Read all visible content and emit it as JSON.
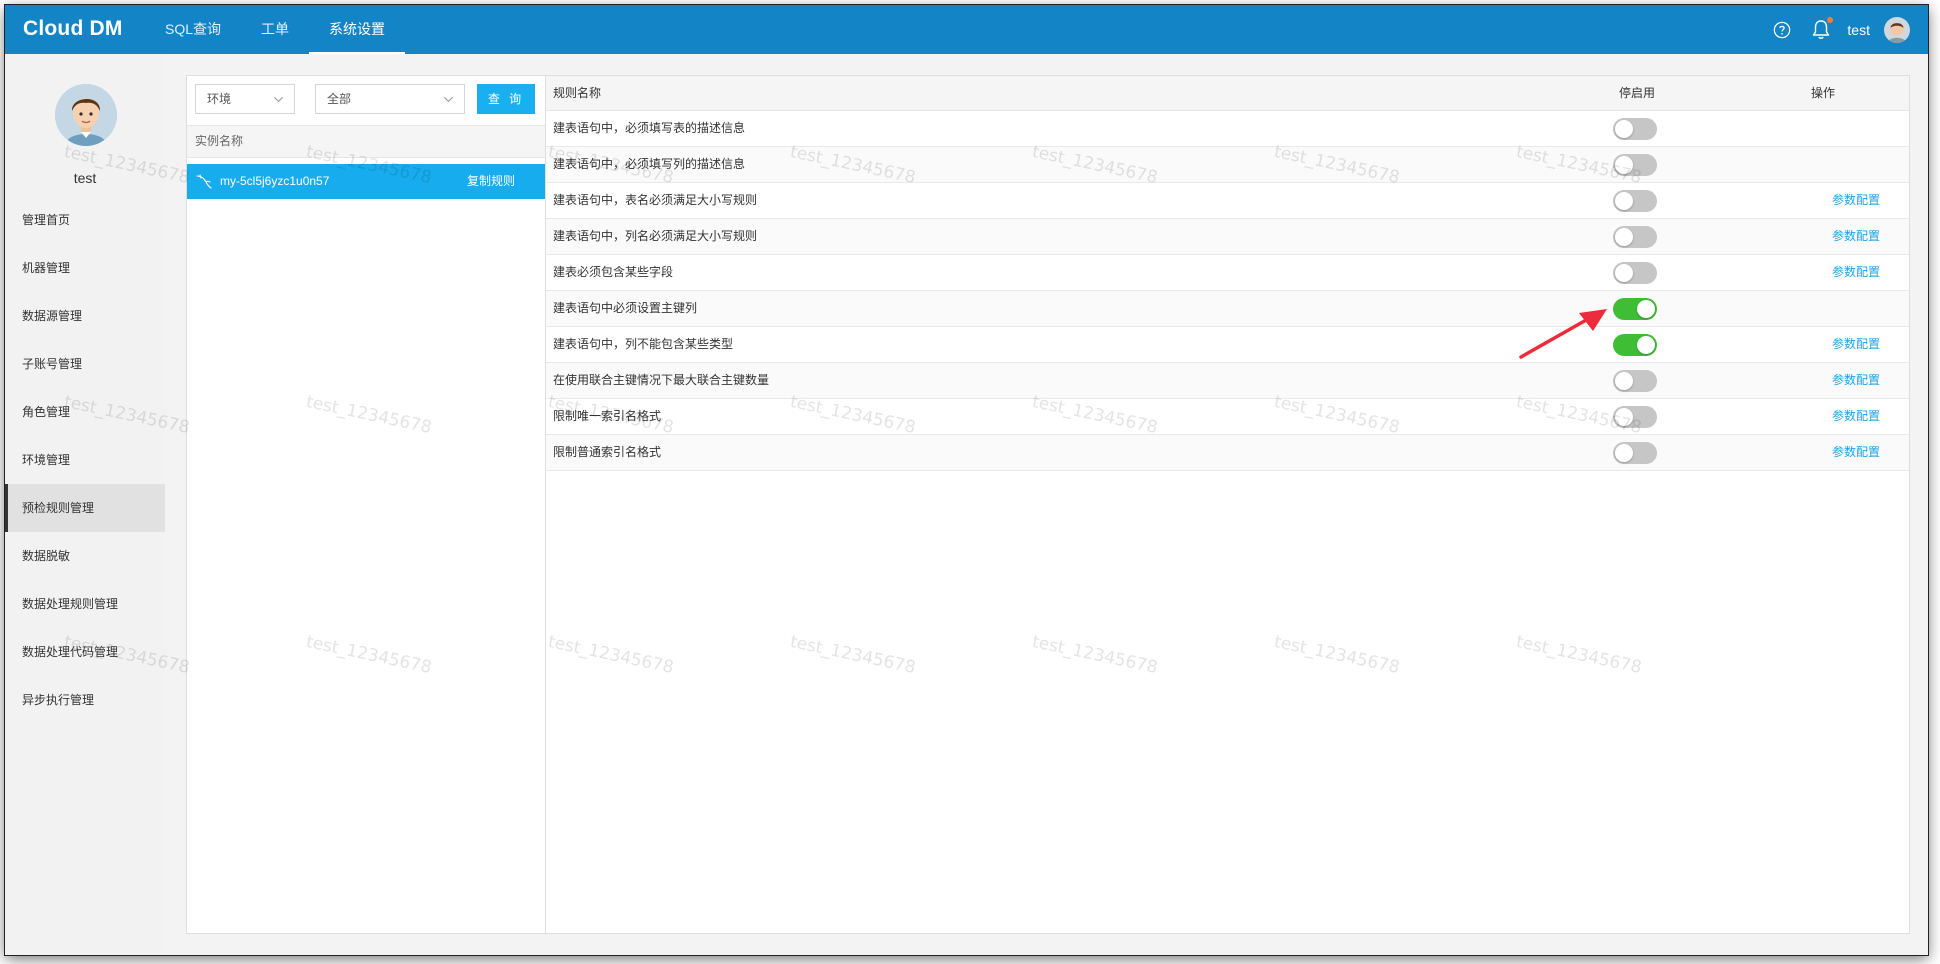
{
  "app": {
    "logo": "Cloud DM"
  },
  "topnav": [
    {
      "label": "SQL查询"
    },
    {
      "label": "工单"
    },
    {
      "label": "系统设置"
    }
  ],
  "top_right": {
    "username": "test",
    "help_icon": "question-circle-icon",
    "bell_icon": "bell-icon"
  },
  "sidebar": {
    "username": "test",
    "items": [
      {
        "label": "管理首页"
      },
      {
        "label": "机器管理"
      },
      {
        "label": "数据源管理"
      },
      {
        "label": "子账号管理"
      },
      {
        "label": "角色管理"
      },
      {
        "label": "环境管理"
      },
      {
        "label": "预检规则管理"
      },
      {
        "label": "数据脱敏"
      },
      {
        "label": "数据处理规则管理"
      },
      {
        "label": "数据处理代码管理"
      },
      {
        "label": "异步执行管理"
      }
    ],
    "active_index": 6
  },
  "left_panel": {
    "filter_env": "环境",
    "filter_all": "全部",
    "query_button": "查 询",
    "header": "实例名称",
    "instance": {
      "name": "my-5cl5j6yzc1u0n57",
      "copy_label": "复制规则"
    }
  },
  "rules_table": {
    "headers": {
      "name": "规则名称",
      "toggle": "停启用",
      "action": "操作"
    },
    "rows": [
      {
        "name": "建表语句中，必须填写表的描述信息",
        "enabled": false,
        "action": ""
      },
      {
        "name": "建表语句中，必须填写列的描述信息",
        "enabled": false,
        "action": ""
      },
      {
        "name": "建表语句中，表名必须满足大小写规则",
        "enabled": false,
        "action": "参数配置"
      },
      {
        "name": "建表语句中，列名必须满足大小写规则",
        "enabled": false,
        "action": "参数配置"
      },
      {
        "name": "建表必须包含某些字段",
        "enabled": false,
        "action": "参数配置"
      },
      {
        "name": "建表语句中必须设置主键列",
        "enabled": true,
        "action": ""
      },
      {
        "name": "建表语句中，列不能包含某些类型",
        "enabled": true,
        "action": "参数配置"
      },
      {
        "name": "在使用联合主键情况下最大联合主键数量",
        "enabled": false,
        "action": "参数配置"
      },
      {
        "name": "限制唯一索引名格式",
        "enabled": false,
        "action": "参数配置"
      },
      {
        "name": "限制普通索引名格式",
        "enabled": false,
        "action": "参数配置"
      }
    ]
  },
  "watermark": "test_12345678",
  "colors": {
    "topbar": "#1384c6",
    "accent": "#17acee",
    "toggle_on": "#3fbe35",
    "link": "#1aa3e8",
    "annotation_arrow": "#ee2b3a"
  }
}
